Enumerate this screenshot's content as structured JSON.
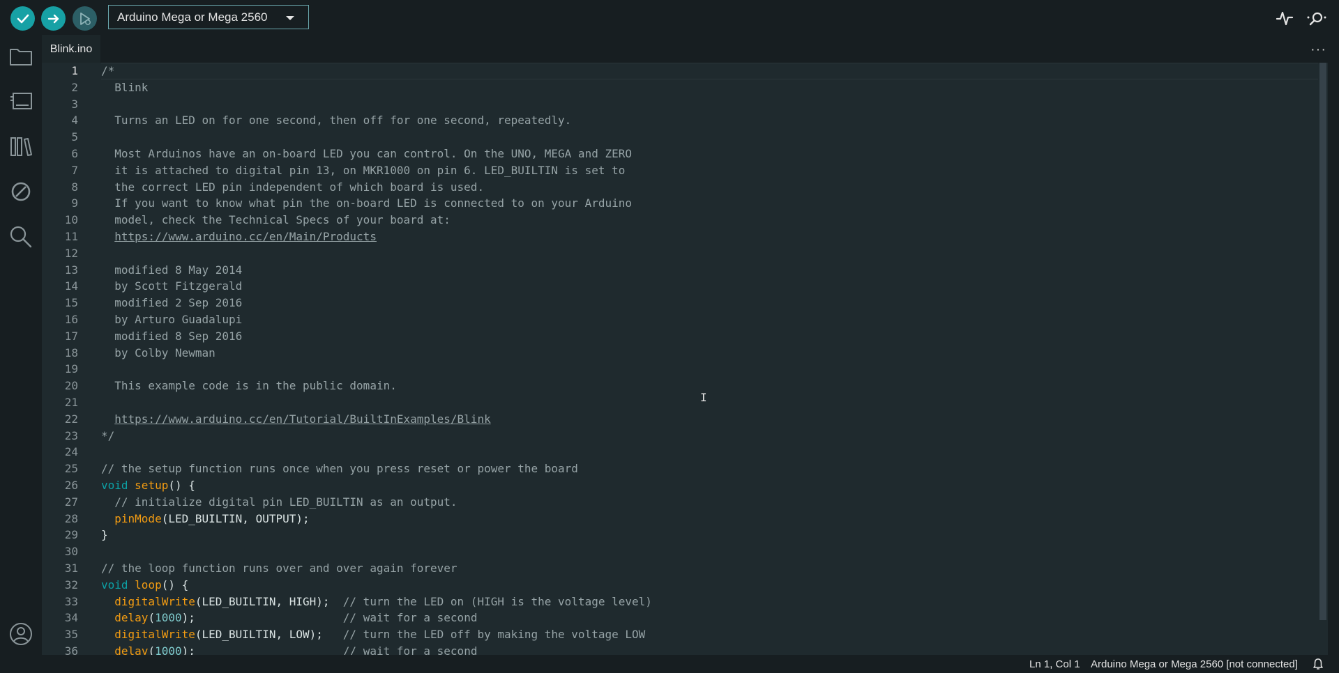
{
  "toolbar": {
    "verify_icon": "check-icon",
    "upload_icon": "arrow-right-icon",
    "debug_icon": "debug-icon",
    "board_selected": "Arduino Mega or Mega 2560",
    "serial_plotter_icon": "pulse-icon",
    "serial_monitor_icon": "magnifier-dots-icon"
  },
  "sidebar": {
    "items": [
      {
        "icon": "folder-icon"
      },
      {
        "icon": "board-icon"
      },
      {
        "icon": "library-icon"
      },
      {
        "icon": "debug-slash-icon"
      },
      {
        "icon": "search-icon"
      }
    ],
    "account_icon": "user-icon"
  },
  "tabs": [
    {
      "label": "Blink.ino",
      "active": true
    }
  ],
  "more_label": "···",
  "editor": {
    "line_numbers": [
      "1",
      "2",
      "3",
      "4",
      "5",
      "6",
      "7",
      "8",
      "9",
      "10",
      "11",
      "12",
      "13",
      "14",
      "15",
      "16",
      "17",
      "18",
      "19",
      "20",
      "21",
      "22",
      "23",
      "24",
      "25",
      "26",
      "27",
      "28",
      "29",
      "30",
      "31",
      "32",
      "33",
      "34",
      "35",
      "36"
    ],
    "lines": [
      [
        {
          "t": "cm",
          "v": "/*"
        }
      ],
      [
        {
          "t": "cm",
          "v": "  Blink"
        }
      ],
      [],
      [
        {
          "t": "cm",
          "v": "  Turns an LED on for one second, then off for one second, repeatedly."
        }
      ],
      [],
      [
        {
          "t": "cm",
          "v": "  Most Arduinos have an on-board LED you can control. On the UNO, MEGA and ZERO"
        }
      ],
      [
        {
          "t": "cm",
          "v": "  it is attached to digital pin 13, on MKR1000 on pin 6. LED_BUILTIN is set to"
        }
      ],
      [
        {
          "t": "cm",
          "v": "  the correct LED pin independent of which board is used."
        }
      ],
      [
        {
          "t": "cm",
          "v": "  If you want to know what pin the on-board LED is connected to on your Arduino"
        }
      ],
      [
        {
          "t": "cm",
          "v": "  model, check the Technical Specs of your board at:"
        }
      ],
      [
        {
          "t": "cm",
          "v": "  "
        },
        {
          "t": "link",
          "v": "https://www.arduino.cc/en/Main/Products"
        }
      ],
      [],
      [
        {
          "t": "cm",
          "v": "  modified 8 May 2014"
        }
      ],
      [
        {
          "t": "cm",
          "v": "  by Scott Fitzgerald"
        }
      ],
      [
        {
          "t": "cm",
          "v": "  modified 2 Sep 2016"
        }
      ],
      [
        {
          "t": "cm",
          "v": "  by Arturo Guadalupi"
        }
      ],
      [
        {
          "t": "cm",
          "v": "  modified 8 Sep 2016"
        }
      ],
      [
        {
          "t": "cm",
          "v": "  by Colby Newman"
        }
      ],
      [],
      [
        {
          "t": "cm",
          "v": "  This example code is in the public domain."
        }
      ],
      [],
      [
        {
          "t": "cm",
          "v": "  "
        },
        {
          "t": "link",
          "v": "https://www.arduino.cc/en/Tutorial/BuiltInExamples/Blink"
        }
      ],
      [
        {
          "t": "cm",
          "v": "*/"
        }
      ],
      [],
      [
        {
          "t": "cm",
          "v": "// the setup function runs once when you press reset or power the board"
        }
      ],
      [
        {
          "t": "kw",
          "v": "void"
        },
        {
          "t": "pl",
          "v": " "
        },
        {
          "t": "fn",
          "v": "setup"
        },
        {
          "t": "pl",
          "v": "() {"
        }
      ],
      [
        {
          "t": "pl",
          "v": "  "
        },
        {
          "t": "cm",
          "v": "// initialize digital pin LED_BUILTIN as an output."
        }
      ],
      [
        {
          "t": "pl",
          "v": "  "
        },
        {
          "t": "fn",
          "v": "pinMode"
        },
        {
          "t": "pl",
          "v": "(LED_BUILTIN, OUTPUT);"
        }
      ],
      [
        {
          "t": "pl",
          "v": "}"
        }
      ],
      [],
      [
        {
          "t": "cm",
          "v": "// the loop function runs over and over again forever"
        }
      ],
      [
        {
          "t": "kw",
          "v": "void"
        },
        {
          "t": "pl",
          "v": " "
        },
        {
          "t": "fn",
          "v": "loop"
        },
        {
          "t": "pl",
          "v": "() {"
        }
      ],
      [
        {
          "t": "pl",
          "v": "  "
        },
        {
          "t": "fn",
          "v": "digitalWrite"
        },
        {
          "t": "pl",
          "v": "(LED_BUILTIN, HIGH);  "
        },
        {
          "t": "cm",
          "v": "// turn the LED on (HIGH is the voltage level)"
        }
      ],
      [
        {
          "t": "pl",
          "v": "  "
        },
        {
          "t": "fn",
          "v": "delay"
        },
        {
          "t": "pl",
          "v": "("
        },
        {
          "t": "num",
          "v": "1000"
        },
        {
          "t": "pl",
          "v": ");                      "
        },
        {
          "t": "cm",
          "v": "// wait for a second"
        }
      ],
      [
        {
          "t": "pl",
          "v": "  "
        },
        {
          "t": "fn",
          "v": "digitalWrite"
        },
        {
          "t": "pl",
          "v": "(LED_BUILTIN, LOW);   "
        },
        {
          "t": "cm",
          "v": "// turn the LED off by making the voltage LOW"
        }
      ],
      [
        {
          "t": "pl",
          "v": "  "
        },
        {
          "t": "fn",
          "v": "delay"
        },
        {
          "t": "pl",
          "v": "("
        },
        {
          "t": "num",
          "v": "1000"
        },
        {
          "t": "pl",
          "v": ");                      "
        },
        {
          "t": "cm",
          "v": "// wait for a second"
        }
      ]
    ]
  },
  "status": {
    "position": "Ln 1, Col 1",
    "board": "Arduino Mega or Mega 2560 [not connected]",
    "bell_icon": "bell-icon"
  },
  "colors": {
    "accent": "#17a1a5",
    "background": "#171e21",
    "editor_bg": "#1f2a2e",
    "keyword": "#0ca1a6",
    "function": "#f39c12",
    "comment": "#96a3a6"
  }
}
